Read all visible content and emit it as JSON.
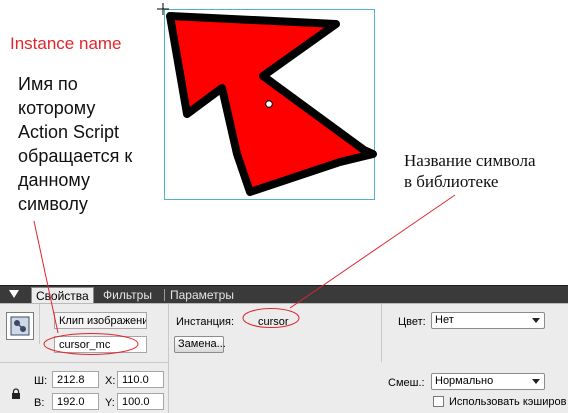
{
  "annotations": {
    "instance_name_title": "Instance name",
    "instance_name_desc_lines": [
      "Имя по",
      "которому",
      "Action Script",
      "обращается к",
      "данному",
      "символу"
    ],
    "symbol_name_desc_lines": [
      "Название символа",
      "в библиотеке"
    ]
  },
  "tabs": [
    {
      "label": "Свойства",
      "active": true
    },
    {
      "label": "Фильтры",
      "active": false
    },
    {
      "label": "Параметры",
      "active": false
    }
  ],
  "properties": {
    "symbol_type_value": "Клип изображени",
    "instance_name_value": "cursor_mc",
    "instance_label": "Инстанция:",
    "instance_symbol_value": "cursor",
    "swap_button_label": "Замена...",
    "color_label": "Цвет:",
    "color_value": "Нет",
    "width_label": "Ш:",
    "width_value": "212.8",
    "height_label": "В:",
    "height_value": "192.0",
    "x_label": "X:",
    "x_value": "110.0",
    "y_label": "Y:",
    "y_value": "100.0",
    "blend_label": "Смеш.:",
    "blend_value": "Нормально",
    "cache_label": "Использовать кэширов"
  },
  "colors": {
    "arrow_fill": "#ff0000",
    "arrow_stroke": "#000000",
    "annotation_red": "#e0262b",
    "stage_box": "#4fb3c8",
    "callout_line": "#e0262b",
    "tabbar": "#3a3a3a",
    "panel": "#ececec"
  },
  "icons": {
    "symbol": "movieclip-symbol-icon",
    "lock": "lock-icon",
    "collapse": "triangle-down-icon",
    "registration": "crosshair-icon",
    "transform_point": "circle-icon"
  }
}
